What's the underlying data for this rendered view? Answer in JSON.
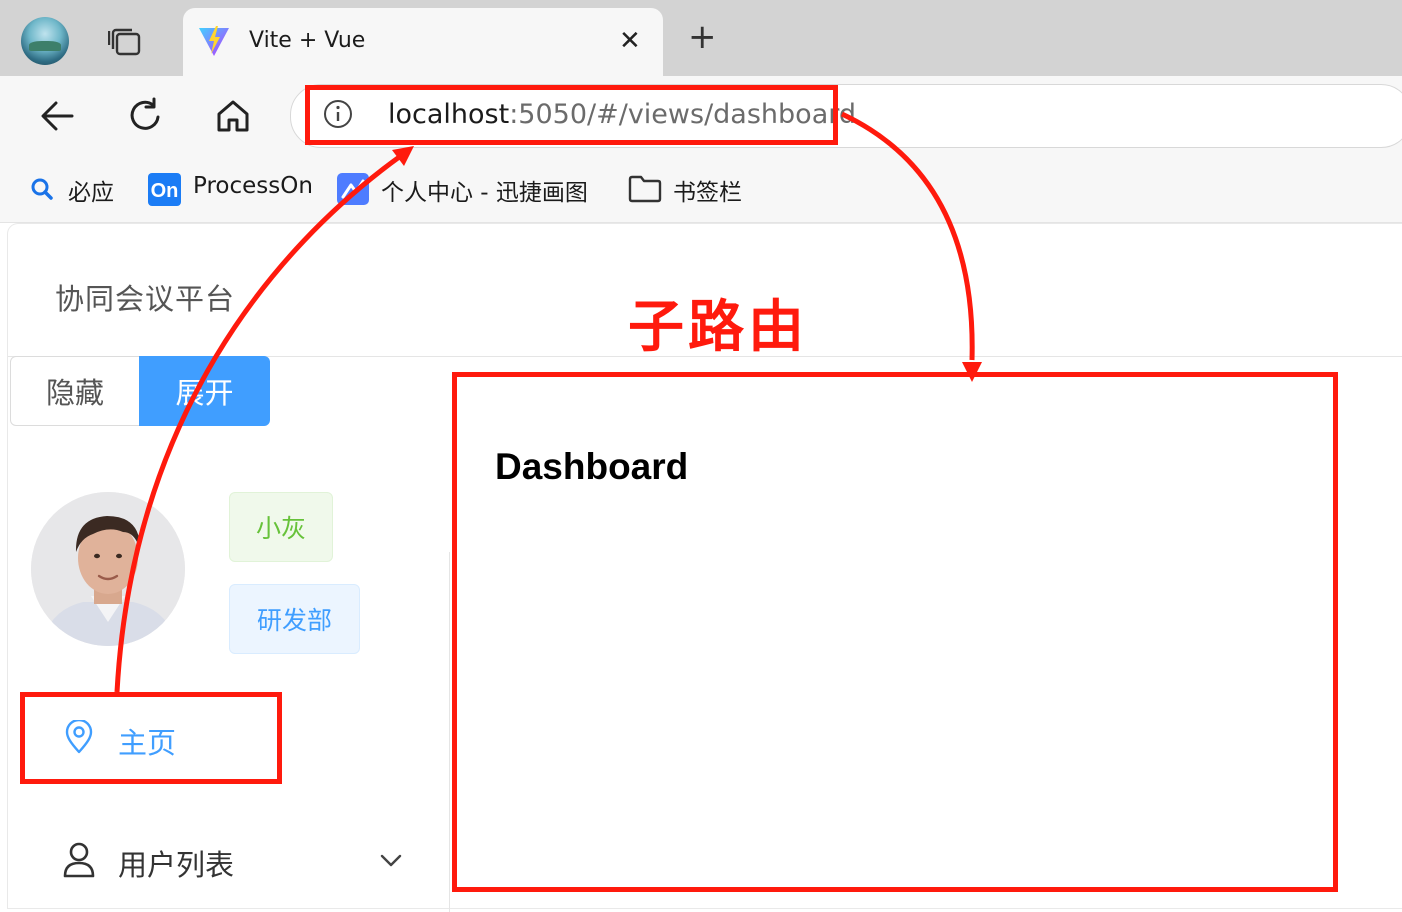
{
  "browser": {
    "tab_title": "Vite + Vue",
    "tab_close": "✕",
    "new_tab": "+",
    "url_host": "localhost",
    "url_path": ":5050/#/views/dashboard",
    "bookmarks": [
      {
        "label": "必应",
        "icon": "search-icon"
      },
      {
        "label": "ProcessOn",
        "icon": "processon-logo"
      },
      {
        "label": "个人中心 - 迅捷画图",
        "icon": "xunjie-logo"
      },
      {
        "label": "书签栏",
        "icon": "folder-icon"
      }
    ]
  },
  "app": {
    "brand": "协同会议平台",
    "btn_hide": "隐藏",
    "btn_show": "展开",
    "user_name": "小灰",
    "user_dept": "研发部",
    "menu_home": "主页",
    "menu_users": "用户列表",
    "content_title": "Dashboard"
  },
  "annotation": {
    "label": "子路由",
    "color": "#ff1a0d"
  },
  "colors": {
    "primary": "#409eff",
    "success": "#67c23a"
  }
}
